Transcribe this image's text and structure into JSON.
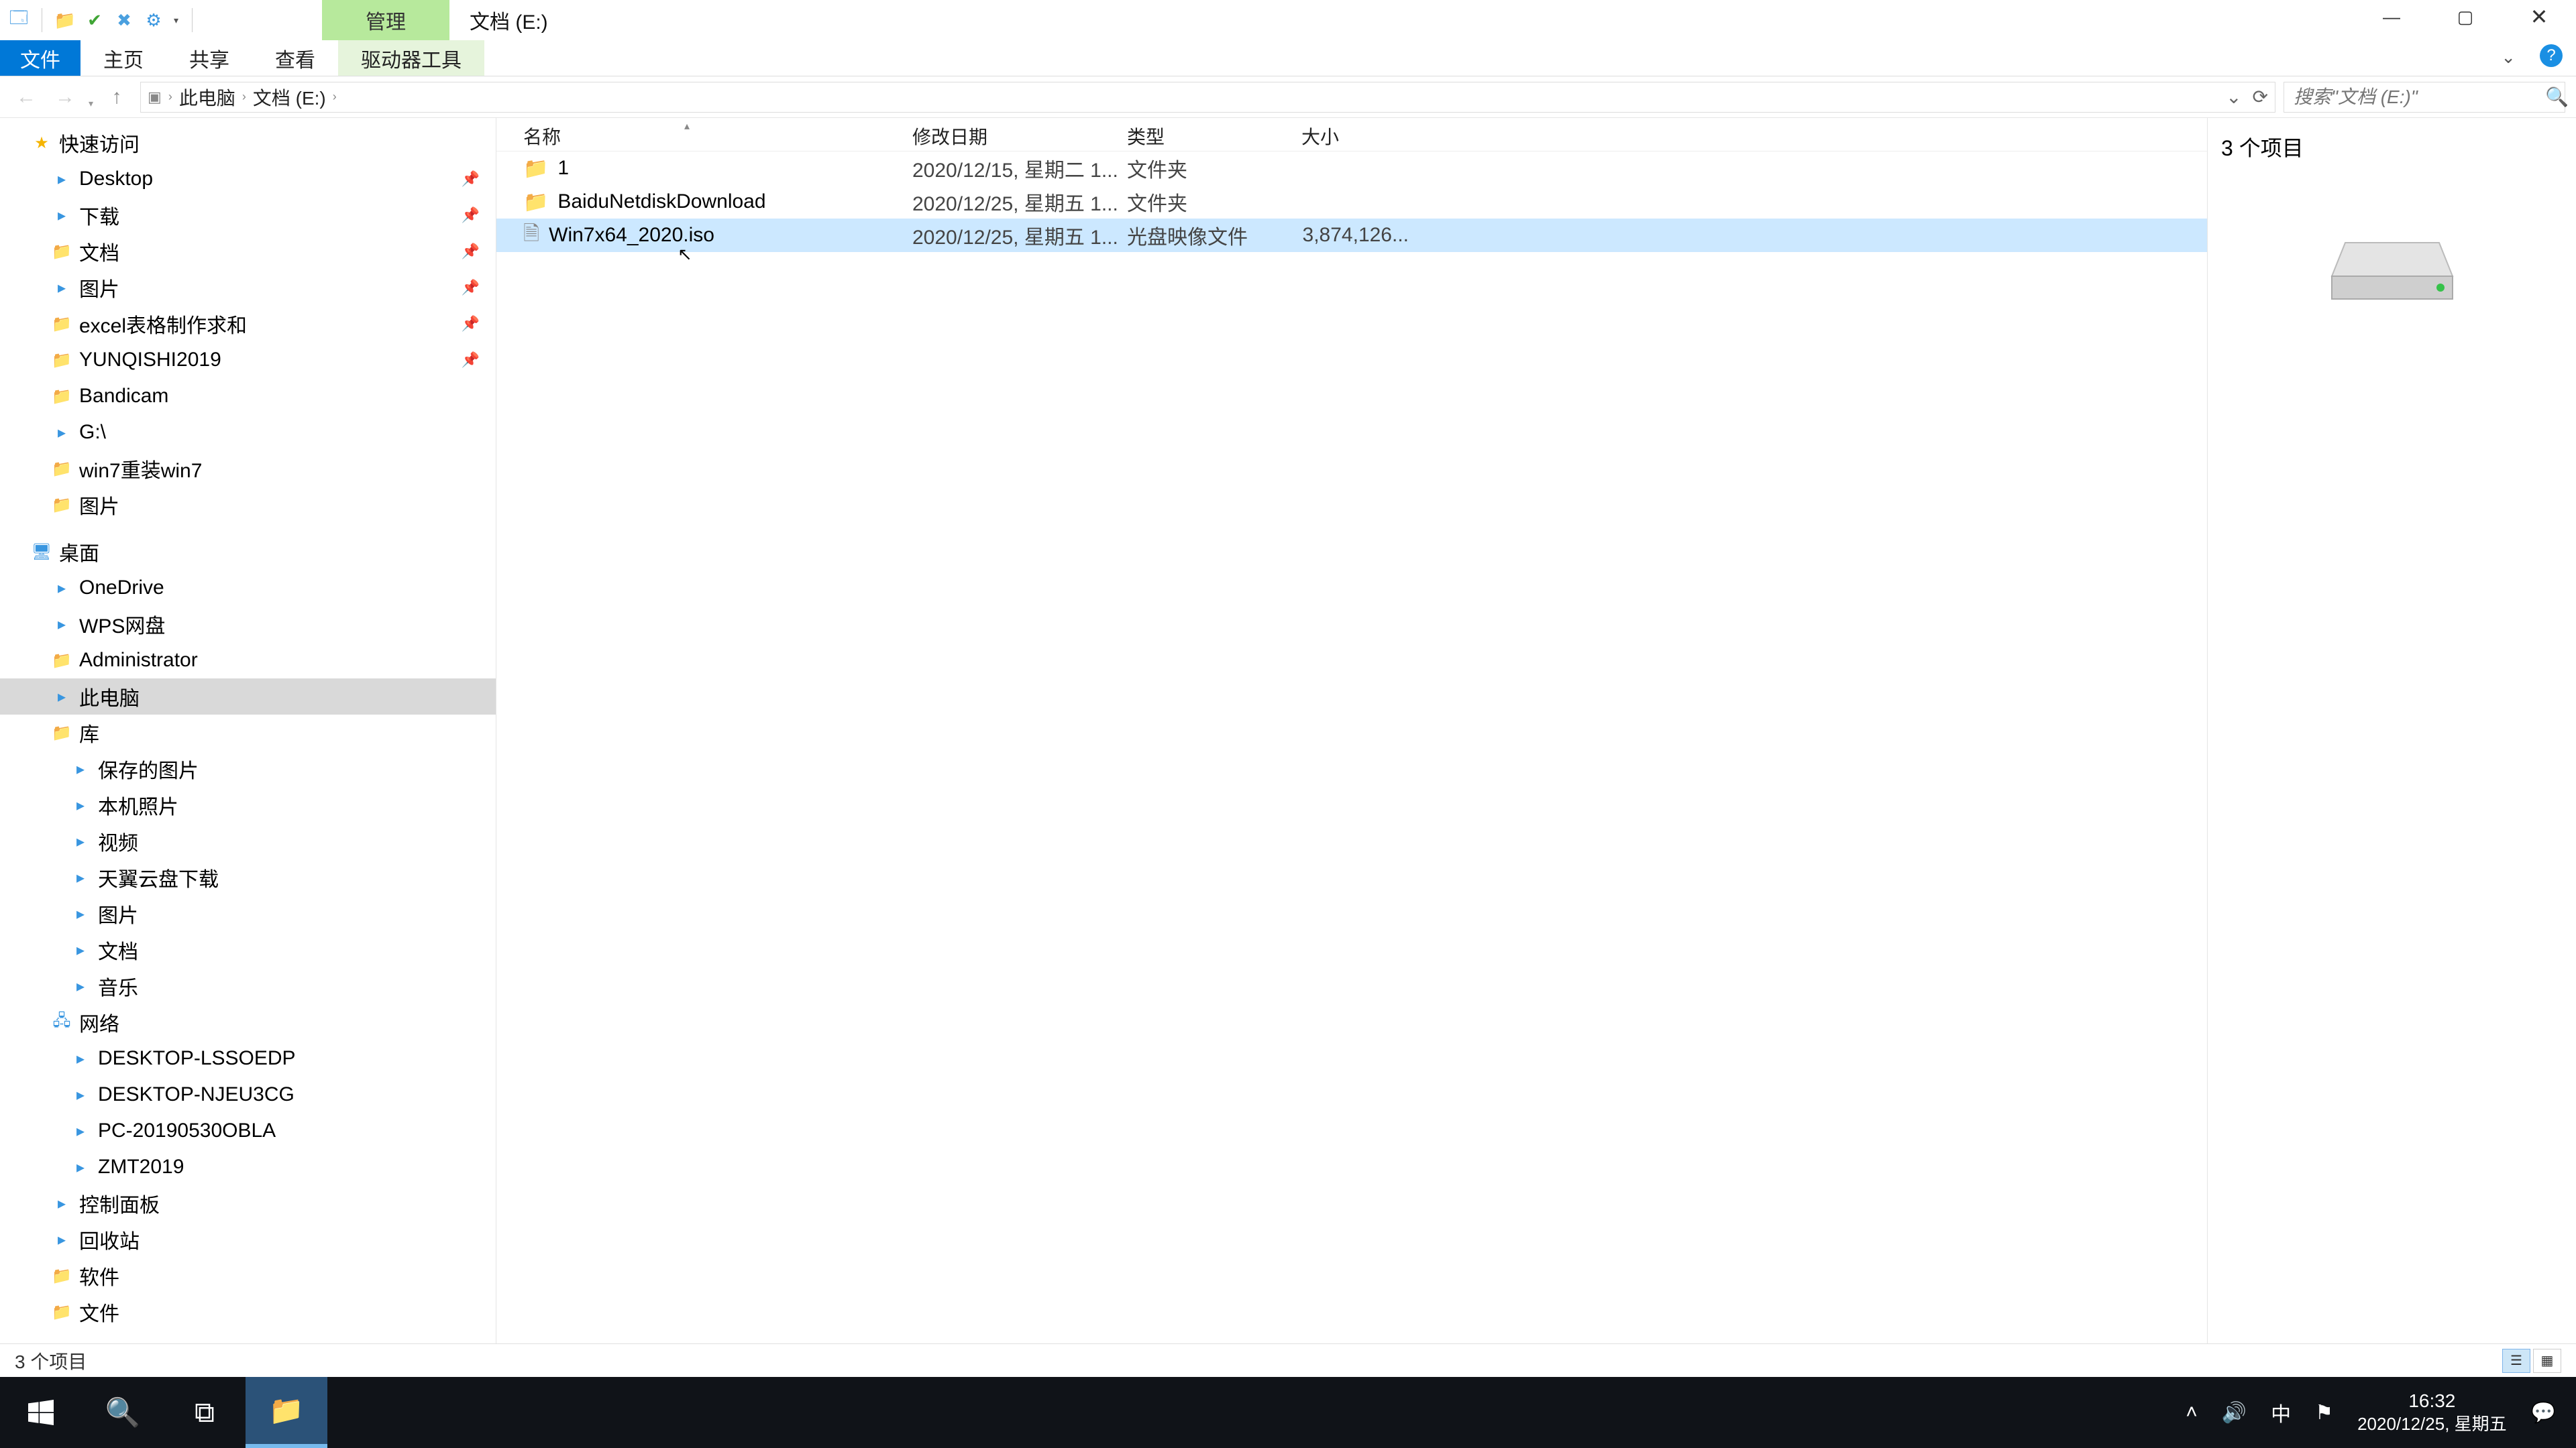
{
  "titlebar": {
    "ribbon_context_label": "管理",
    "title": "文档 (E:)"
  },
  "ribbon": {
    "file": "文件",
    "tabs": [
      "主页",
      "共享",
      "查看",
      "驱动器工具"
    ]
  },
  "address": {
    "crumbs": [
      "此电脑",
      "文档 (E:)"
    ],
    "search_placeholder": "搜索\"文档 (E:)\""
  },
  "nav": {
    "quick_access": "快速访问",
    "quick_items": [
      {
        "label": "Desktop",
        "pin": true,
        "icon": "ic-blue"
      },
      {
        "label": "下载",
        "pin": true,
        "icon": "ic-blue"
      },
      {
        "label": "文档",
        "pin": true,
        "icon": "ic-folder"
      },
      {
        "label": "图片",
        "pin": true,
        "icon": "ic-blue"
      },
      {
        "label": "excel表格制作求和",
        "pin": true,
        "icon": "ic-folder"
      },
      {
        "label": "YUNQISHI2019",
        "pin": true,
        "icon": "ic-folder"
      },
      {
        "label": "Bandicam",
        "pin": false,
        "icon": "ic-folder"
      },
      {
        "label": "G:\\",
        "pin": false,
        "icon": "ic-blue"
      },
      {
        "label": "win7重装win7",
        "pin": false,
        "icon": "ic-folder"
      },
      {
        "label": "图片",
        "pin": false,
        "icon": "ic-folder"
      }
    ],
    "desktop_group": "桌面",
    "desktop_items": [
      {
        "label": "OneDrive",
        "icon": "ic-blue"
      },
      {
        "label": "WPS网盘",
        "icon": "ic-blue"
      },
      {
        "label": "Administrator",
        "icon": "ic-folder"
      },
      {
        "label": "此电脑",
        "icon": "ic-blue",
        "selected": true
      },
      {
        "label": "库",
        "icon": "ic-folder"
      }
    ],
    "lib_items": [
      {
        "label": "保存的图片",
        "icon": "ic-blue"
      },
      {
        "label": "本机照片",
        "icon": "ic-blue"
      },
      {
        "label": "视频",
        "icon": "ic-blue"
      },
      {
        "label": "天翼云盘下载",
        "icon": "ic-blue"
      },
      {
        "label": "图片",
        "icon": "ic-blue"
      },
      {
        "label": "文档",
        "icon": "ic-blue"
      },
      {
        "label": "音乐",
        "icon": "ic-blue"
      }
    ],
    "network_group": "网络",
    "network_items": [
      {
        "label": "DESKTOP-LSSOEDP",
        "icon": "ic-blue"
      },
      {
        "label": "DESKTOP-NJEU3CG",
        "icon": "ic-blue"
      },
      {
        "label": "PC-20190530OBLA",
        "icon": "ic-blue"
      },
      {
        "label": "ZMT2019",
        "icon": "ic-blue"
      }
    ],
    "bottom_items": [
      {
        "label": "控制面板",
        "icon": "ic-blue"
      },
      {
        "label": "回收站",
        "icon": "ic-blue"
      },
      {
        "label": "软件",
        "icon": "ic-folder"
      },
      {
        "label": "文件",
        "icon": "ic-folder"
      }
    ]
  },
  "columns": {
    "name": "名称",
    "date": "修改日期",
    "type": "类型",
    "size": "大小"
  },
  "files": [
    {
      "name": "1",
      "date": "2020/12/15, 星期二 1...",
      "type": "文件夹",
      "size": "",
      "icon": "ic-folder",
      "selected": false
    },
    {
      "name": "BaiduNetdiskDownload",
      "date": "2020/12/25, 星期五 1...",
      "type": "文件夹",
      "size": "",
      "icon": "ic-folder",
      "selected": false
    },
    {
      "name": "Win7x64_2020.iso",
      "date": "2020/12/25, 星期五 1...",
      "type": "光盘映像文件",
      "size": "3,874,126...",
      "icon": "ic-gray",
      "selected": true
    }
  ],
  "preview": {
    "title": "3 个项目"
  },
  "statusbar": {
    "text": "3 个项目"
  },
  "taskbar": {
    "ime": "中",
    "time": "16:32",
    "date": "2020/12/25, 星期五"
  }
}
